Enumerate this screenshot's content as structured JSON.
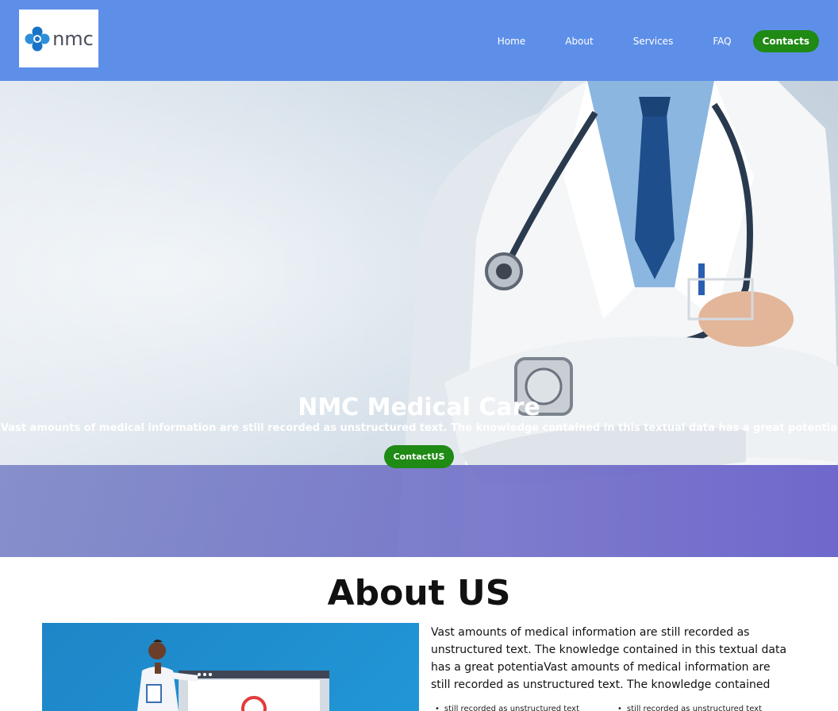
{
  "header": {
    "logo_text": "nmc",
    "nav": [
      {
        "label": "Home"
      },
      {
        "label": "About"
      },
      {
        "label": "Services"
      },
      {
        "label": "FAQ"
      }
    ],
    "cta_label": "Contacts"
  },
  "hero": {
    "title": "NMC Medical Care",
    "subtitle": "Vast amounts of medical information are still recorded as unstructured text. The knowledge contained in this textual data has a great potentia",
    "cta_label": "ContactUS"
  },
  "about": {
    "title": "About US",
    "paragraph": "Vast amounts of medical information are still recorded as unstructured text. The knowledge contained in this textual data has a great potentiaVast amounts of medical information are still recorded as unstructured text. The knowledge contained",
    "list_items": [
      "still recorded as unstructured text",
      "still recorded as unstructured text"
    ]
  },
  "colors": {
    "navbar": "#5e8fe8",
    "accent_green": "#1f8a14",
    "overlay_purple": "#6f6cc8",
    "about_image_blue": "#1d86c7"
  }
}
